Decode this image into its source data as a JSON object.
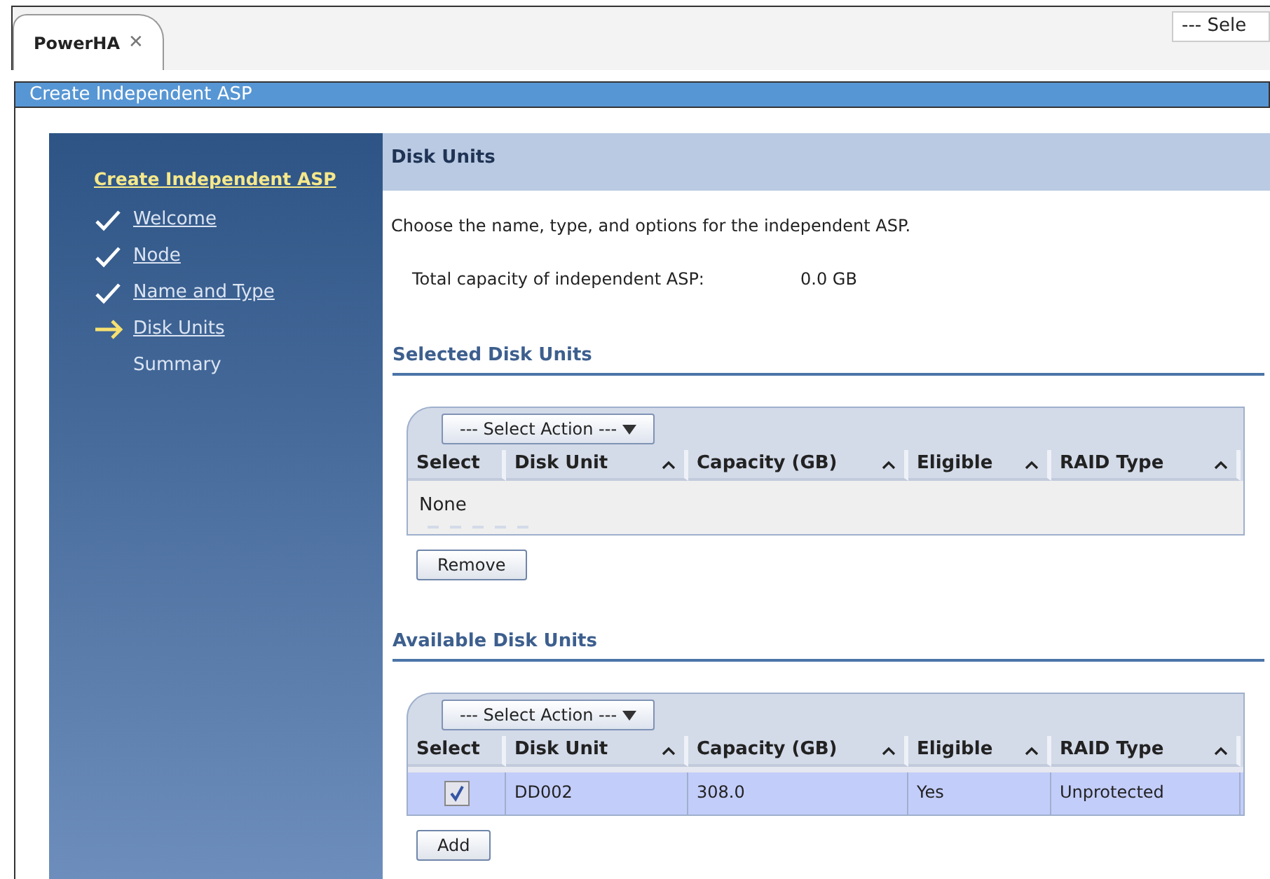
{
  "tabs": [
    {
      "label": "PowerHA",
      "close": "✕",
      "selected": true
    }
  ],
  "top_select": {
    "value": "--- Sele"
  },
  "title_bar": {
    "title": "Create Independent ASP"
  },
  "wizard": {
    "title": "Create Independent ASP",
    "steps": [
      {
        "label": "Welcome",
        "kind": "done"
      },
      {
        "label": "Node",
        "kind": "done"
      },
      {
        "label": "Name and Type",
        "kind": "done"
      },
      {
        "label": "Disk Units",
        "kind": "current"
      },
      {
        "label": "Summary",
        "kind": "pending"
      }
    ]
  },
  "page": {
    "heading": "Disk Units",
    "description": "Choose the name, type, and options for the independent ASP.",
    "capacity_label": "Total capacity of independent ASP:",
    "capacity_value": "0.0 GB"
  },
  "sections": [
    {
      "heading": "Selected Disk Units",
      "action": "--- Select Action ---",
      "select_header": "Select",
      "columns": [
        "Disk Unit",
        "Capacity (GB)",
        "Eligible",
        "RAID Type"
      ],
      "empty_text": "None",
      "button": "Remove"
    },
    {
      "heading": "Available Disk Units",
      "action": "--- Select Action ---",
      "select_header": "Select",
      "columns": [
        "Disk Unit",
        "Capacity (GB)",
        "Eligible",
        "RAID Type"
      ],
      "rows": [
        {
          "checked": true,
          "cells": [
            "DD002",
            "308.0",
            "Yes",
            "Unprotected"
          ]
        }
      ],
      "button": "Add"
    }
  ]
}
